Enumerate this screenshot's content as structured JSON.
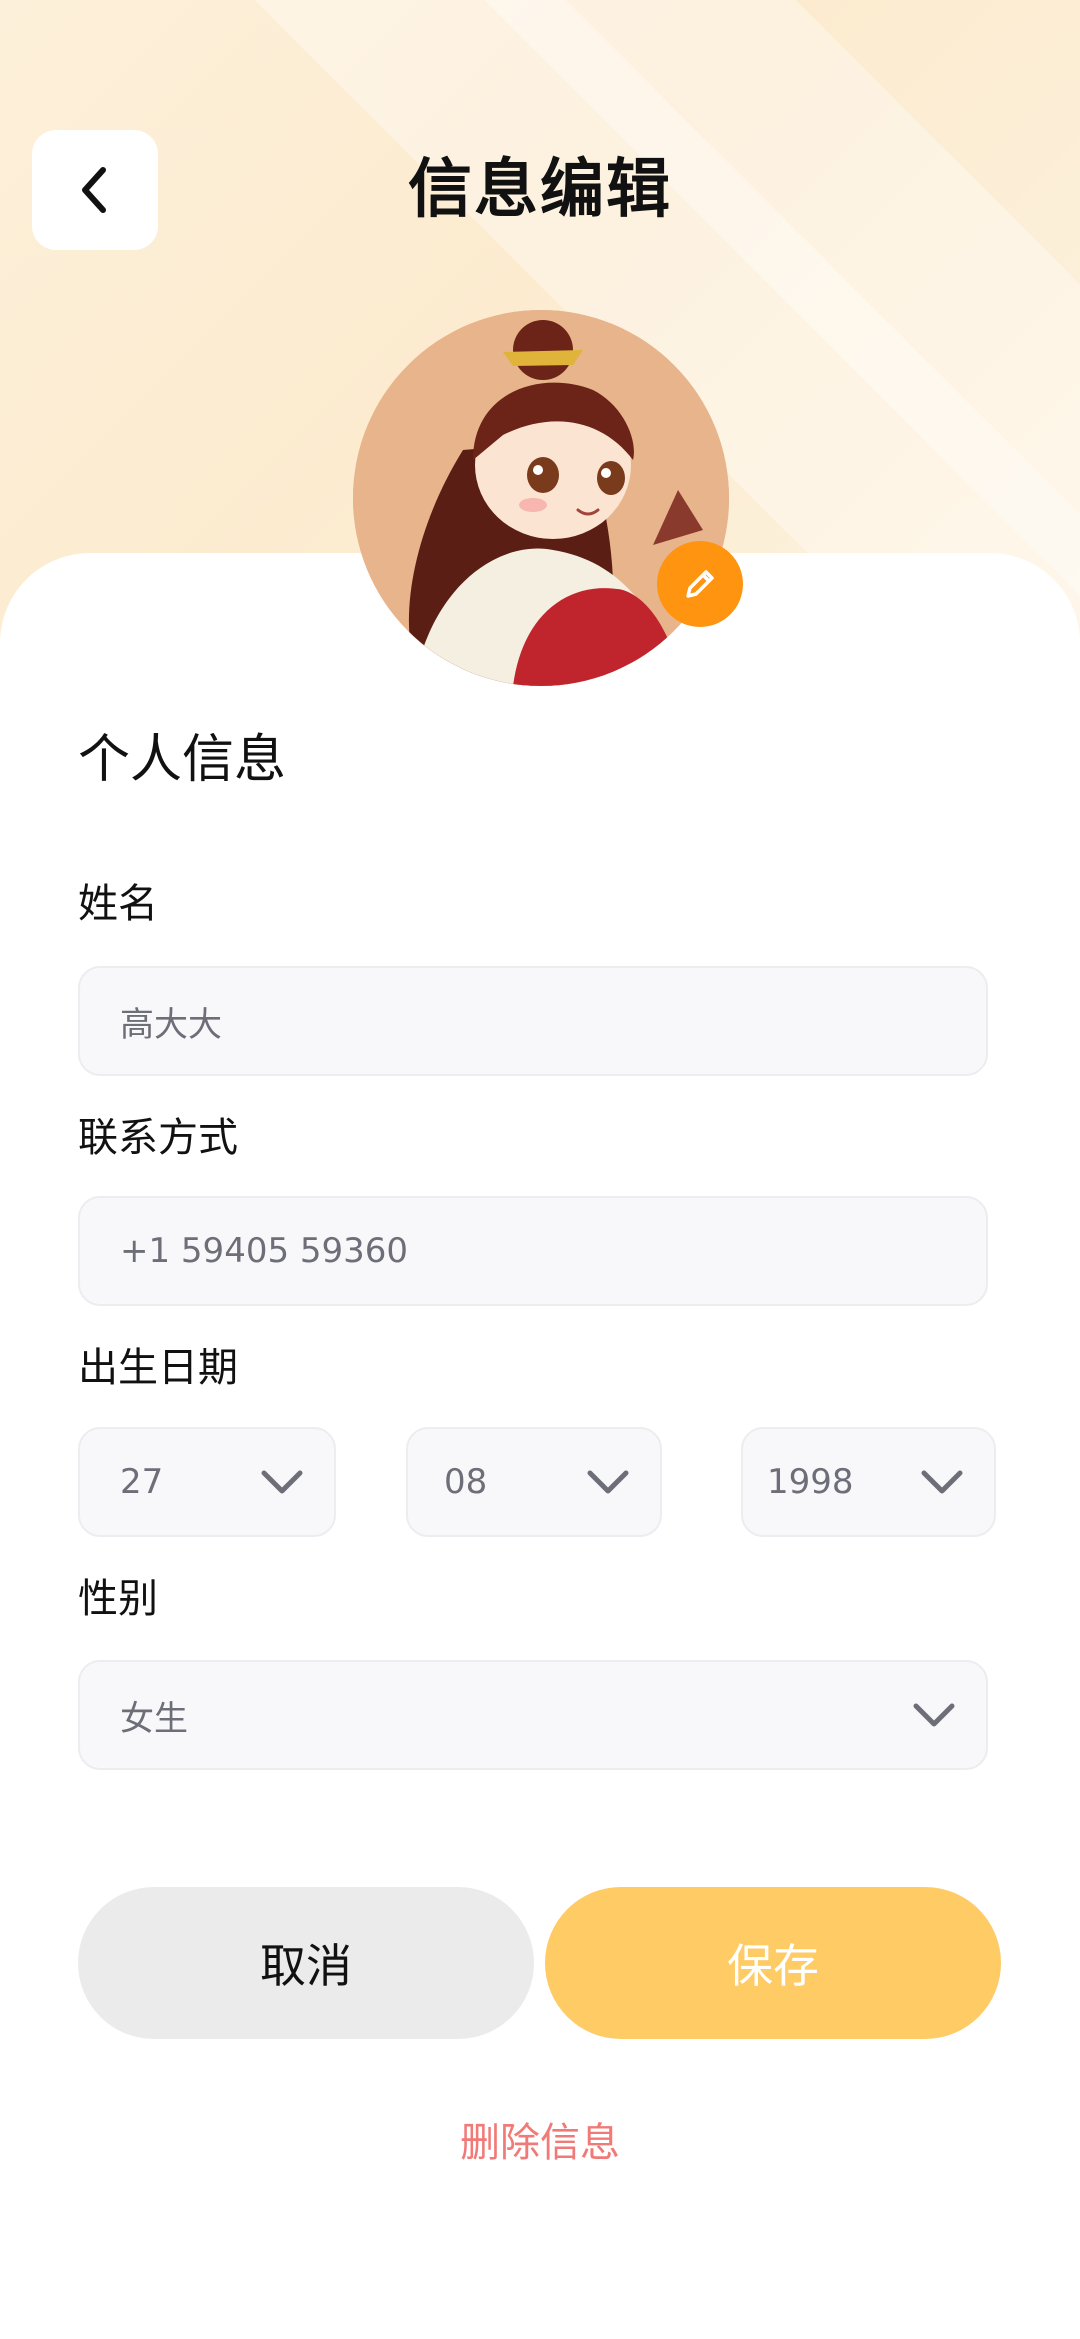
{
  "header": {
    "title": "信息编辑"
  },
  "icons": {
    "back": "chevron-left-icon",
    "edit": "pencil-icon",
    "dropdown": "chevron-down-icon"
  },
  "colors": {
    "accent": "#ff9410",
    "save_button": "#fecb64",
    "delete_text": "#f07a77",
    "header_background": "#fcebcf"
  },
  "form": {
    "section_title": "个人信息",
    "name": {
      "label": "姓名",
      "value": "高大大"
    },
    "contact": {
      "label": "联系方式",
      "value": "+1 59405 59360"
    },
    "birthday": {
      "label": "出生日期",
      "day": "27",
      "month": "08",
      "year": "1998"
    },
    "gender": {
      "label": "性别",
      "value": "女生"
    }
  },
  "actions": {
    "cancel": "取消",
    "save": "保存",
    "delete": "删除信息"
  }
}
